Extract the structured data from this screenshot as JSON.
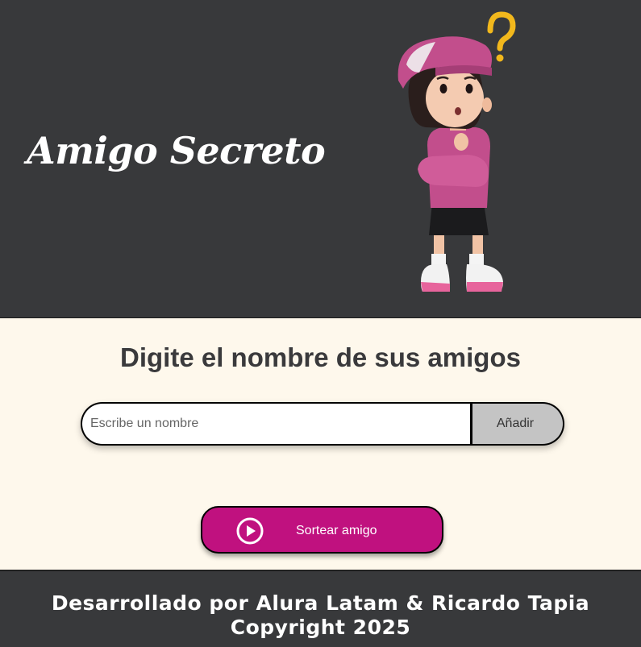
{
  "header": {
    "title": "Amigo Secreto",
    "illustration": "thinking-girl-with-question-mark"
  },
  "main": {
    "subtitle": "Digite el nombre de sus amigos",
    "name_input": {
      "value": "",
      "placeholder": "Escribe un nombre"
    },
    "add_button_label": "Añadir",
    "draw_button_label": "Sortear amigo",
    "draw_button_icon": "play-circle-icon"
  },
  "footer": {
    "line1": "Desarrollado por Alura Latam & Ricardo Tapia",
    "line2": "Copyright 2025"
  },
  "colors": {
    "header_bg": "#38393b",
    "page_bg": "#fef8ec",
    "accent": "#c0117f",
    "add_button_bg": "#c4c4c4",
    "footer_bg": "#38393b"
  }
}
